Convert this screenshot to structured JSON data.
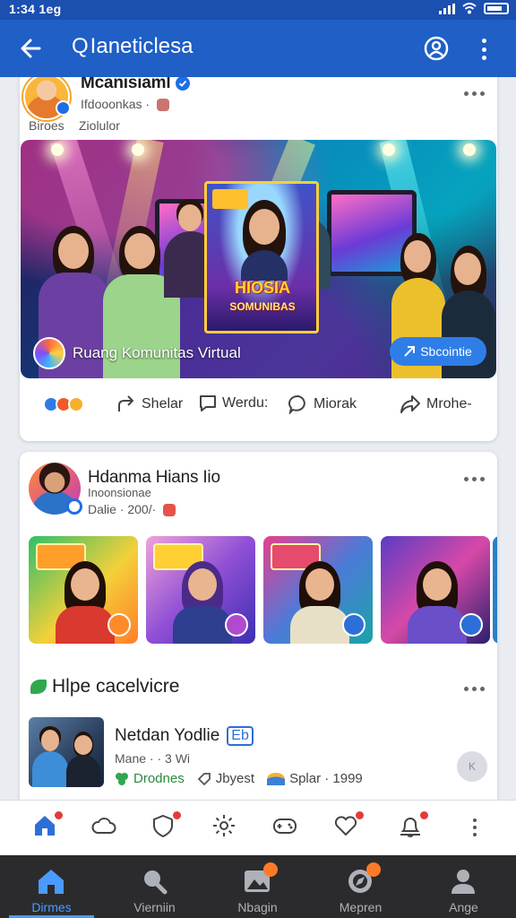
{
  "status_bar": {
    "time": "1:34 1eg"
  },
  "app_bar": {
    "title": "Ianeticlesa",
    "search_glyph": "Q"
  },
  "post1": {
    "author": "Mcanisiaml",
    "meta": "Ifdooonkas ·",
    "label_left": "Biroes",
    "label_right": "Ziolulor",
    "banner_poster_title": "HIOSIA",
    "banner_poster_subtitle": "SOMUNIBAS",
    "banner_caption": "Ruang Komunitas Virtual",
    "banner_button": "Sbcointie",
    "actions": {
      "share": "Shelar",
      "comment": "Werdu:",
      "message": "Miorak",
      "more": "Mrohe-"
    }
  },
  "post2": {
    "author": "Hdanma Hians Iio",
    "handle": "Inoonsionae",
    "meta": "Dalie · 200/·",
    "section_title": "Hlpe cacelvicre",
    "video": {
      "title": "Netdan Yodlie",
      "title_badge": "Eb",
      "meta": "Mane · · 3 Wi",
      "stat1": "Drodnes",
      "stat2": "Jbyest",
      "stat3": "Splar · 1999",
      "fab": "K"
    }
  },
  "bottom_nav": {
    "items": [
      {
        "label": "Dirmes",
        "icon": "home-icon"
      },
      {
        "label": "Vierniin",
        "icon": "search-icon"
      },
      {
        "label": "Nbagin",
        "icon": "image-icon"
      },
      {
        "label": "Mepren",
        "icon": "compass-icon"
      },
      {
        "label": "Ange",
        "icon": "profile-icon"
      }
    ]
  },
  "colors": {
    "brand_blue": "#1f5fc6",
    "nav_active": "#4a9bff",
    "badge_red": "#e23b3b"
  }
}
